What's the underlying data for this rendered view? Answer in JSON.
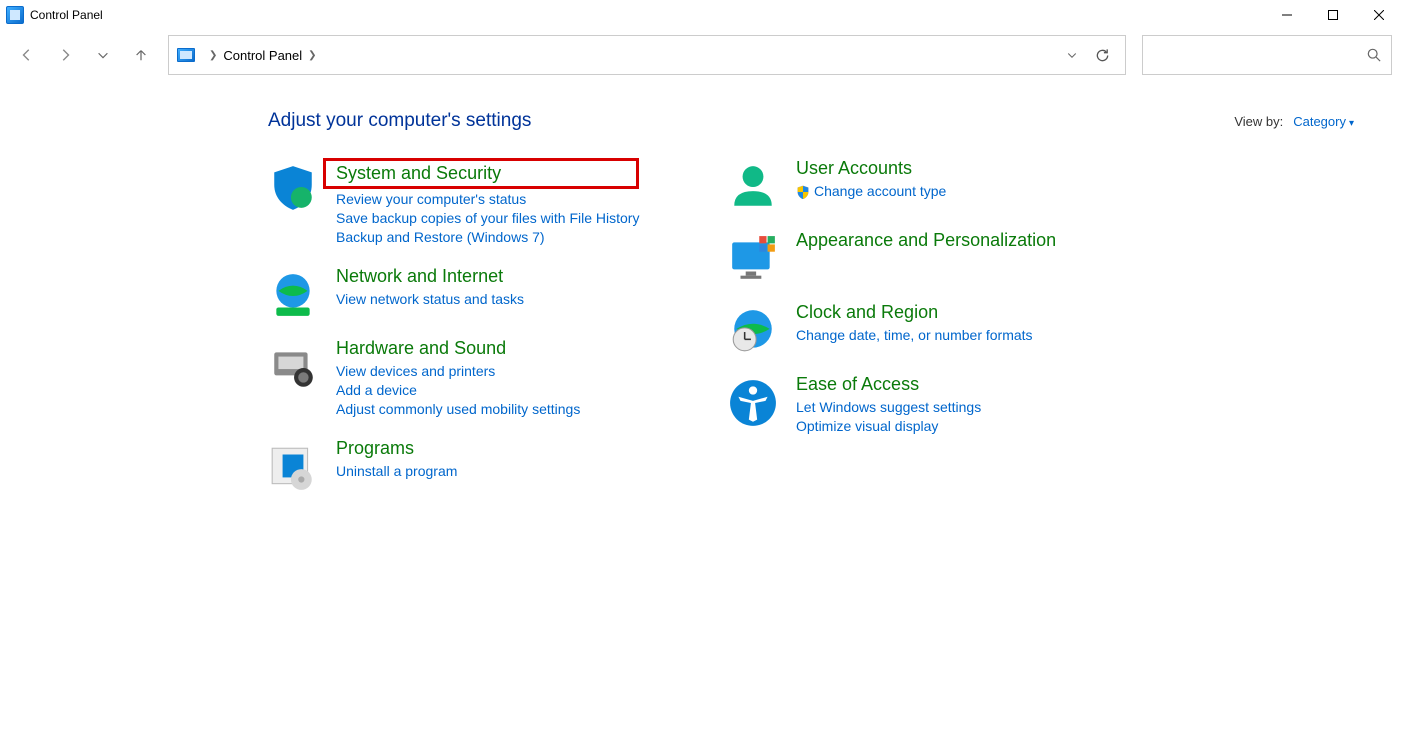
{
  "window": {
    "title": "Control Panel"
  },
  "breadcrumb": {
    "root": "Control Panel"
  },
  "page_title": "Adjust your computer's settings",
  "viewby": {
    "label": "View by:",
    "value": "Category"
  },
  "left": {
    "system_security": {
      "title": "System and Security",
      "links": {
        "review": "Review your computer's status",
        "filehistory": "Save backup copies of your files with File History",
        "backup": "Backup and Restore (Windows 7)"
      }
    },
    "network": {
      "title": "Network and Internet",
      "links": {
        "status": "View network status and tasks"
      }
    },
    "hardware": {
      "title": "Hardware and Sound",
      "links": {
        "devices": "View devices and printers",
        "add": "Add a device",
        "mobility": "Adjust commonly used mobility settings"
      }
    },
    "programs": {
      "title": "Programs",
      "links": {
        "uninstall": "Uninstall a program"
      }
    }
  },
  "right": {
    "accounts": {
      "title": "User Accounts",
      "links": {
        "change_type": "Change account type"
      }
    },
    "appearance": {
      "title": "Appearance and Personalization"
    },
    "clock": {
      "title": "Clock and Region",
      "links": {
        "change_dt": "Change date, time, or number formats"
      }
    },
    "ease": {
      "title": "Ease of Access",
      "links": {
        "suggest": "Let Windows suggest settings",
        "visual": "Optimize visual display"
      }
    }
  }
}
